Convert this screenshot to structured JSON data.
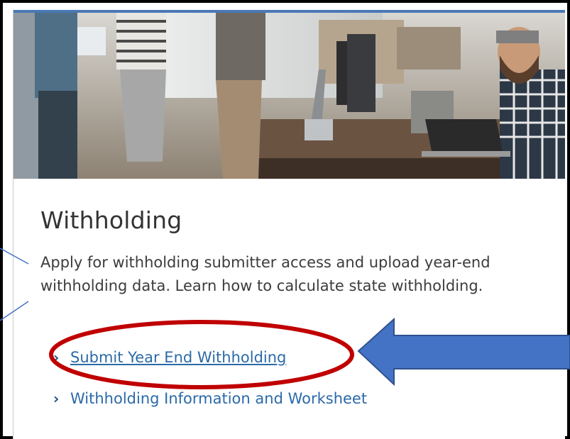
{
  "card": {
    "title": "Withholding",
    "description": "Apply for withholding submitter access and upload year-end withholding data. Learn how to calculate state withholding.",
    "links": [
      {
        "label": "Submit Year End Withholding",
        "highlighted": true
      },
      {
        "label": "Withholding Information and Worksheet",
        "highlighted": false
      }
    ]
  },
  "colors": {
    "accent_bar": "#4a78b5",
    "link": "#2b6aa8",
    "annotation_ellipse": "#c00000",
    "annotation_arrow": "#4472c4"
  }
}
